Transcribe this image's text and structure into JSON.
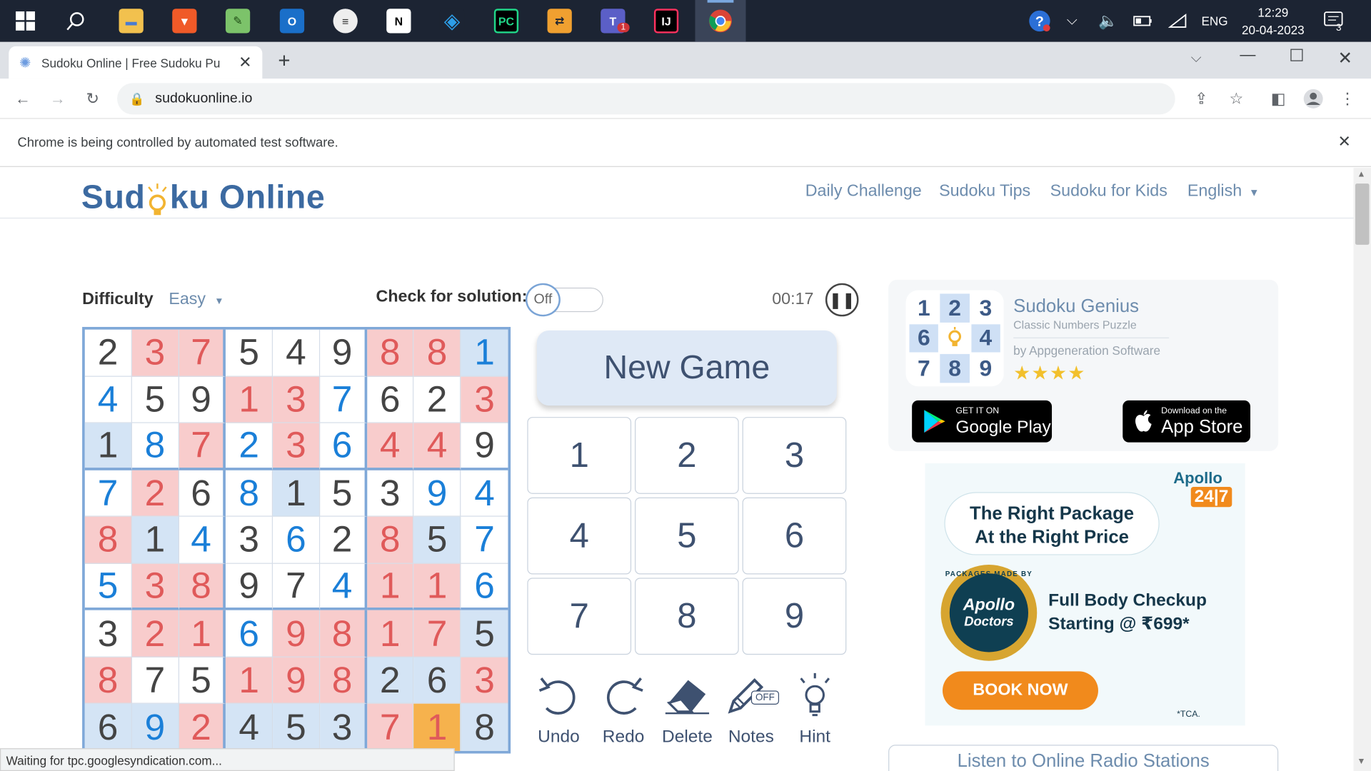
{
  "taskbar": {
    "apps": [
      "windows-start",
      "search",
      "file-explorer",
      "brave",
      "notepad",
      "outlook",
      "app-6",
      "notion",
      "vscode",
      "pycharm",
      "app-10",
      "teams",
      "intellij",
      "chrome"
    ],
    "tray_lang": "ENG",
    "time": "12:29",
    "date": "20-04-2023",
    "notif_count": "3",
    "teams_badge": "1"
  },
  "browser": {
    "tab_title": "Sudoku Online | Free Sudoku Pu",
    "url": "sudokuonline.io",
    "infobar_text": "Chrome is being controlled by automated test software.",
    "status_text": "Waiting for tpc.googlesyndication.com..."
  },
  "site": {
    "logo_text_1": "Sud",
    "logo_text_2": "ku Online",
    "nav": [
      "Daily Challenge",
      "Sudoku Tips",
      "Sudoku for Kids",
      "English"
    ]
  },
  "controls": {
    "difficulty_label": "Difficulty",
    "difficulty_value": "Easy",
    "check_label": "Check for solution:",
    "toggle_state": "Off",
    "timer": "00:17",
    "new_game": "New Game",
    "numpad": [
      "1",
      "2",
      "3",
      "4",
      "5",
      "6",
      "7",
      "8",
      "9"
    ],
    "tools": [
      "Undo",
      "Redo",
      "Delete",
      "Notes",
      "Hint"
    ],
    "notes_badge": "OFF"
  },
  "board": {
    "values": [
      [
        "2",
        "3",
        "7",
        "5",
        "4",
        "9",
        "8",
        "8",
        "1"
      ],
      [
        "4",
        "5",
        "9",
        "1",
        "3",
        "7",
        "6",
        "2",
        "3"
      ],
      [
        "1",
        "8",
        "7",
        "2",
        "3",
        "6",
        "4",
        "4",
        "9"
      ],
      [
        "7",
        "2",
        "6",
        "8",
        "1",
        "5",
        "3",
        "9",
        "4"
      ],
      [
        "8",
        "1",
        "4",
        "3",
        "6",
        "2",
        "8",
        "5",
        "7"
      ],
      [
        "5",
        "3",
        "8",
        "9",
        "7",
        "4",
        "1",
        "1",
        "6"
      ],
      [
        "3",
        "2",
        "1",
        "6",
        "9",
        "8",
        "1",
        "7",
        "5"
      ],
      [
        "8",
        "7",
        "5",
        "1",
        "9",
        "8",
        "2",
        "6",
        "3"
      ],
      [
        "6",
        "9",
        "2",
        "4",
        "5",
        "3",
        "7",
        "1",
        "8"
      ]
    ],
    "states": [
      [
        "g",
        "e",
        "e",
        "g",
        "g",
        "g",
        "e",
        "e",
        "hu"
      ],
      [
        "u",
        "g",
        "g",
        "e",
        "e",
        "u",
        "g",
        "g",
        "e"
      ],
      [
        "hg",
        "u",
        "e",
        "u",
        "e",
        "u",
        "e",
        "e",
        "g"
      ],
      [
        "u",
        "e",
        "g",
        "u",
        "hg",
        "g",
        "g",
        "u",
        "u"
      ],
      [
        "e",
        "hg",
        "u",
        "g",
        "u",
        "g",
        "e",
        "hg",
        "u"
      ],
      [
        "u",
        "e",
        "e",
        "g",
        "g",
        "u",
        "e",
        "e",
        "u"
      ],
      [
        "g",
        "e",
        "e",
        "u",
        "e",
        "e",
        "e",
        "e",
        "hg"
      ],
      [
        "e",
        "g",
        "g",
        "e",
        "e",
        "e",
        "hg",
        "hg",
        "e"
      ],
      [
        "hg",
        "hu",
        "e",
        "hg",
        "hg",
        "hg",
        "e",
        "s",
        "hg"
      ]
    ]
  },
  "app_promo": {
    "logo_digits": [
      "1",
      "2",
      "3",
      "6",
      "",
      "4",
      "7",
      "8",
      "9"
    ],
    "title": "Sudoku Genius",
    "subtitle": "Classic Numbers Puzzle",
    "publisher": "by Appgeneration Software",
    "rating_stars": 4,
    "google_small": "GET IT ON",
    "google_big": "Google Play",
    "apple_small": "Download on the",
    "apple_big": "App Store"
  },
  "ad": {
    "brand": "Apollo",
    "brand_tag": "24|7",
    "headline_1": "The Right Package",
    "headline_2": "At the Right Price",
    "seal_top": "PACKAGES MADE BY",
    "seal_text_1": "Apollo",
    "seal_text_2": "Doctors",
    "offer_1": "Full Body Checkup",
    "offer_2": "Starting @ ₹699*",
    "cta": "BOOK NOW",
    "fine_print": "*TCA."
  },
  "radio_link": "Listen to Online Radio Stations",
  "colors": {
    "accent_blue": "#3c6aa1",
    "error_bg": "#f8cccc",
    "error_text": "#e05a5a",
    "selected_bg": "#f6b24d",
    "ad_orange": "#f18a1c"
  }
}
